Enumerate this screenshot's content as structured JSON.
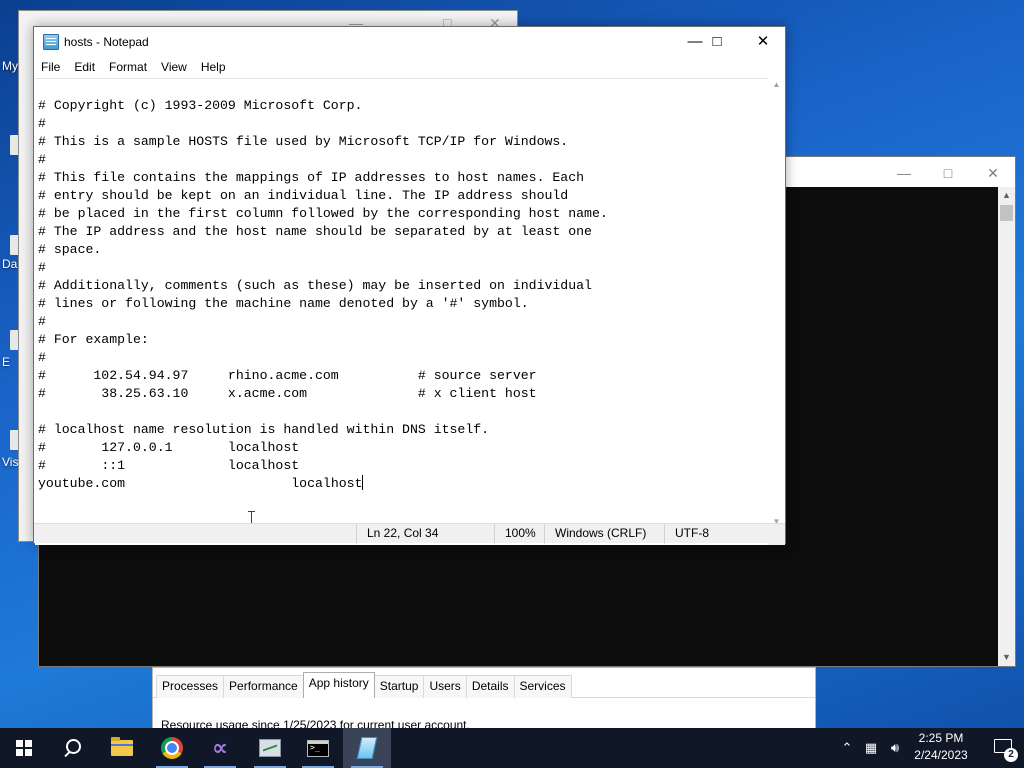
{
  "desktop": {
    "icon_labels": [
      "My",
      "Da",
      "E",
      "Vis"
    ]
  },
  "notepad": {
    "title": "hosts - Notepad",
    "menu": [
      "File",
      "Edit",
      "Format",
      "View",
      "Help"
    ],
    "lines": [
      "# Copyright (c) 1993-2009 Microsoft Corp.",
      "#",
      "# This is a sample HOSTS file used by Microsoft TCP/IP for Windows.",
      "#",
      "# This file contains the mappings of IP addresses to host names. Each",
      "# entry should be kept on an individual line. The IP address should",
      "# be placed in the first column followed by the corresponding host name.",
      "# The IP address and the host name should be separated by at least one",
      "# space.",
      "#",
      "# Additionally, comments (such as these) may be inserted on individual",
      "# lines or following the machine name denoted by a '#' symbol.",
      "#",
      "# For example:",
      "#",
      "#      102.54.94.97     rhino.acme.com          # source server",
      "#       38.25.63.10     x.acme.com              # x client host",
      "",
      "# localhost name resolution is handled within DNS itself.",
      "#\t127.0.0.1       localhost",
      "#\t::1             localhost"
    ],
    "last_line": "youtube.com\t\t\tlocalhost",
    "status": {
      "position": "Ln 22, Col 34",
      "zoom": "100%",
      "line_ending": "Windows (CRLF)",
      "encoding": "UTF-8"
    }
  },
  "taskmgr": {
    "tabs": [
      "Processes",
      "Performance",
      "App history",
      "Startup",
      "Users",
      "Details",
      "Services"
    ],
    "active_tab": "App history",
    "resource_text": "Resource usage since 1/25/2023 for current user account."
  },
  "taskbar": {
    "apps": [
      "start-icon",
      "search-icon",
      "file-explorer-icon",
      "chrome-icon",
      "visual-studio-icon",
      "performance-monitor-icon",
      "command-prompt-icon",
      "notepad-icon"
    ],
    "time": "2:25 PM",
    "date": "2/24/2023",
    "notification_count": "2"
  }
}
